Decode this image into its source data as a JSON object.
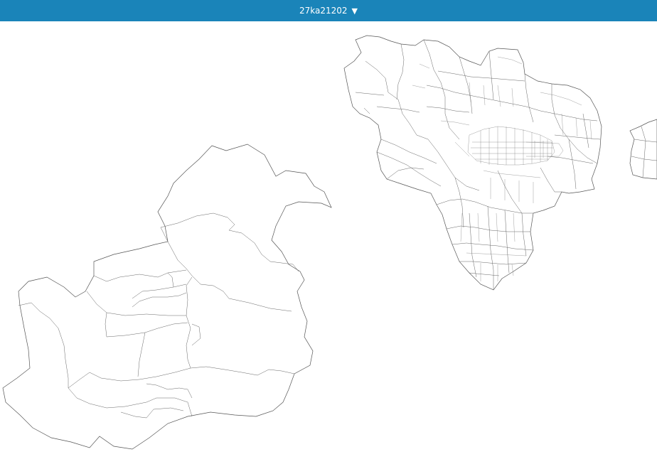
{
  "header": {
    "area_code": "27ka21202",
    "dropdown_icon": "triangle-down-icon",
    "background_color": "#1a84b9",
    "text_color": "#ffffff"
  },
  "map": {
    "boundary_color": "#555555",
    "fill_color": "#ffffff"
  }
}
